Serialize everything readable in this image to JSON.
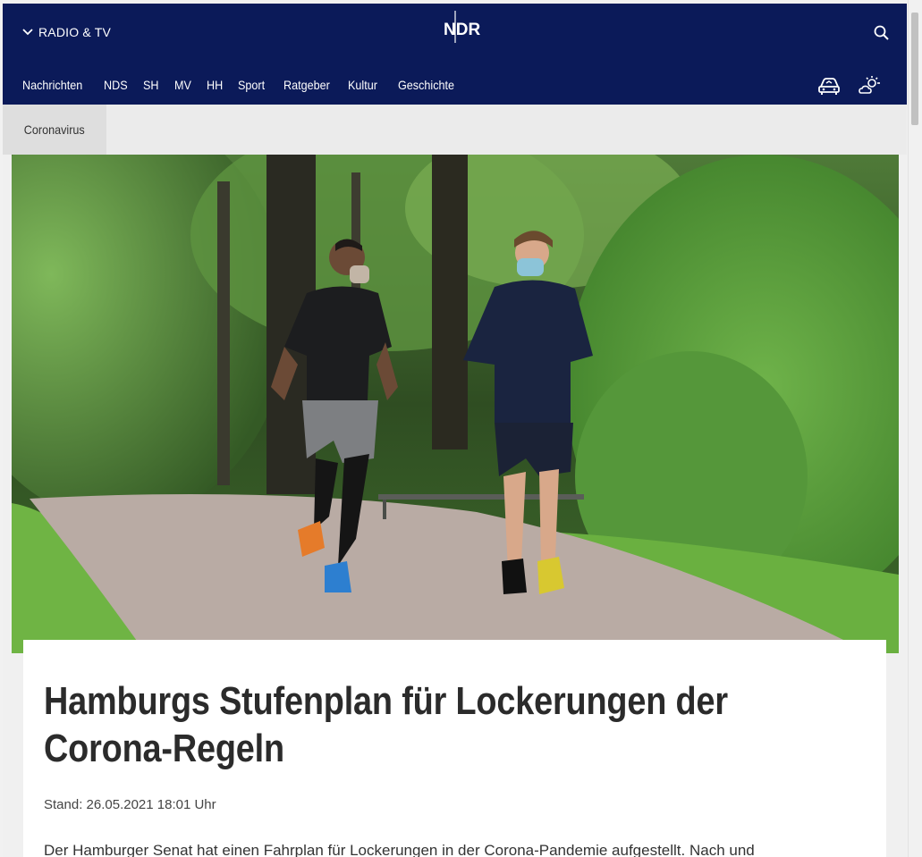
{
  "header": {
    "menu_label": "RADIO & TV",
    "logo_text": "NDR",
    "brand_color": "#0b1a59",
    "icons": {
      "menu": "chevron-down-icon",
      "search": "search-icon",
      "traffic": "traffic-car-icon",
      "weather": "weather-sun-cloud-icon"
    }
  },
  "nav": {
    "items": [
      {
        "label": "Nachrichten"
      },
      {
        "label": "NDS"
      },
      {
        "label": "SH"
      },
      {
        "label": "MV"
      },
      {
        "label": "HH"
      },
      {
        "label": "Sport"
      },
      {
        "label": "Ratgeber"
      },
      {
        "label": "Kultur"
      },
      {
        "label": "Geschichte"
      }
    ]
  },
  "subnav": {
    "active_item": "Coronavirus"
  },
  "article": {
    "headline": "Hamburgs Stufenplan für Lockerungen der Corona-Regeln",
    "stand": "Stand: 26.05.2021 18:01 Uhr",
    "teaser": "Der Hamburger Senat hat einen Fahrplan für Lockerungen in der Corona-Pandemie aufgestellt. Nach und"
  },
  "hero_image": {
    "subject": "two-joggers-with-masks-in-park"
  }
}
